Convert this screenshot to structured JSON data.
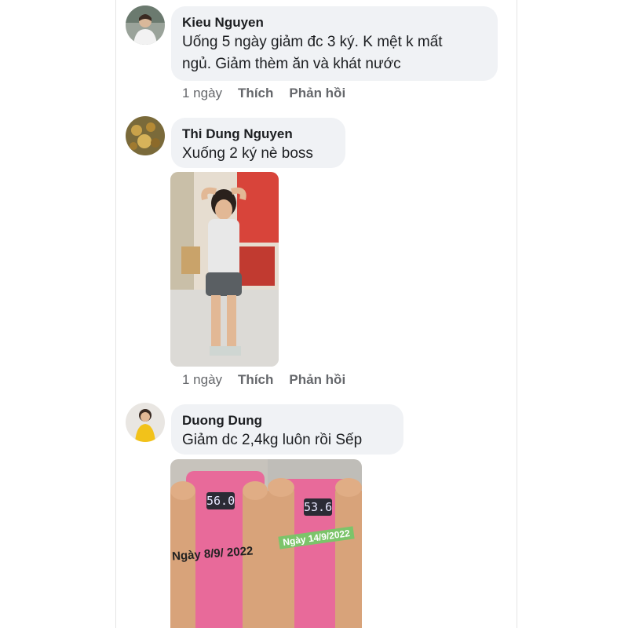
{
  "comments": [
    {
      "author": "Kieu Nguyen",
      "text_line1": "Uống 5 ngày giảm đc 3 ký. K mệt k mất",
      "text_line2": "ngủ. Giảm thèm ăn và khát nước",
      "time": "1 ngày",
      "like": "Thích",
      "reply": "Phản hồi"
    },
    {
      "author": "Thi Dung Nguyen",
      "text_line1": "Xuống 2 ký nè boss",
      "time": "1 ngày",
      "like": "Thích",
      "reply": "Phản hồi"
    },
    {
      "author": "Duong Dung",
      "text_line1": "Giảm dc 2,4kg luôn rồi Sếp",
      "photo_left": {
        "display": "56.0",
        "label": "Ngày 8/9/ 2022"
      },
      "photo_right": {
        "display": "53.6",
        "label": "Ngày 14/9/2022"
      }
    }
  ],
  "colors": {
    "bubble": "#f0f2f5",
    "meta": "#65676b",
    "scale_pink": "#e86a9a",
    "date_badge": "#7cc46a"
  },
  "icons": [
    "avatar-kieu-nguyen",
    "avatar-thi-dung-nguyen",
    "avatar-duong-dung"
  ]
}
